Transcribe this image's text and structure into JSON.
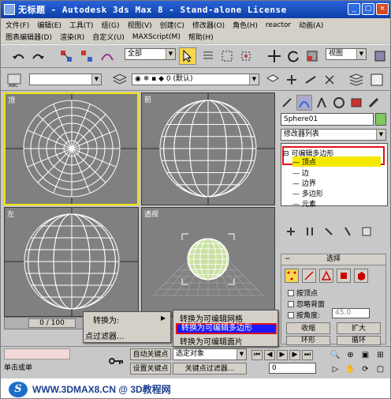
{
  "window": {
    "title": "无标题 - Autodesk 3ds Max 8 - Stand-alone License",
    "min": "_",
    "max": "□",
    "close": "×"
  },
  "menu": {
    "row1": [
      "文件(F)",
      "编辑(E)",
      "工具(T)",
      "组(G)",
      "视图(V)",
      "创建(C)",
      "修改器(O)",
      "角色(H)",
      "reactor",
      "动画(A)"
    ],
    "row2": [
      "图表编辑器(D)",
      "渲染(R)",
      "自定义(U)",
      "MAXScript(M)",
      "帮助(H)"
    ]
  },
  "toolbar": {
    "selection_filter": "全部",
    "coord_system": "视图"
  },
  "layer_bar": {
    "layer_label": "0 (默认)"
  },
  "viewports": [
    {
      "label": "顶"
    },
    {
      "label": "前"
    },
    {
      "label": "左"
    },
    {
      "label": "透视"
    }
  ],
  "command_panel": {
    "object_name": "Sphere01",
    "modifier_list": "修改器列表",
    "stack": {
      "root": "可编辑多边形",
      "items": [
        "顶点",
        "边",
        "边界",
        "多边形",
        "元素"
      ],
      "selected": "顶点"
    },
    "rollout_title": "选择",
    "checkboxes": [
      "按顶点",
      "忽略背面"
    ],
    "by_angle_label": "按角度:",
    "by_angle_value": "45.0",
    "shrink": "收缩",
    "grow": "扩大",
    "ring": "环形",
    "loop": "循环"
  },
  "timeline": {
    "frame": "0 / 100"
  },
  "context_menu": {
    "convert_to": "转换为:",
    "vertex_filter": "点过滤器...",
    "items": [
      "转换为可编辑网格",
      "转换为可编辑多边形",
      "转换为可编辑面片"
    ],
    "highlighted": "转换为可编辑多边形"
  },
  "bottom": {
    "auto_key": "自动关键点",
    "selected_object": "选定对象",
    "set_key": "设置关键点",
    "key_filter": "关键点过滤器...",
    "frame_value": "0",
    "click_or_drag": "单击或单"
  },
  "watermark": {
    "text": "WWW.3DMAX8.CN @ 3D教程网",
    "logo": "S"
  },
  "colors": {
    "titlebar": "#0b3fa8",
    "selection_highlight": "#f0e400",
    "context_highlight": "#1a1aff",
    "red_outline": "#e0101c",
    "mesh_wire": "#ffffff",
    "mesh_vertex": "#2a2af0"
  }
}
